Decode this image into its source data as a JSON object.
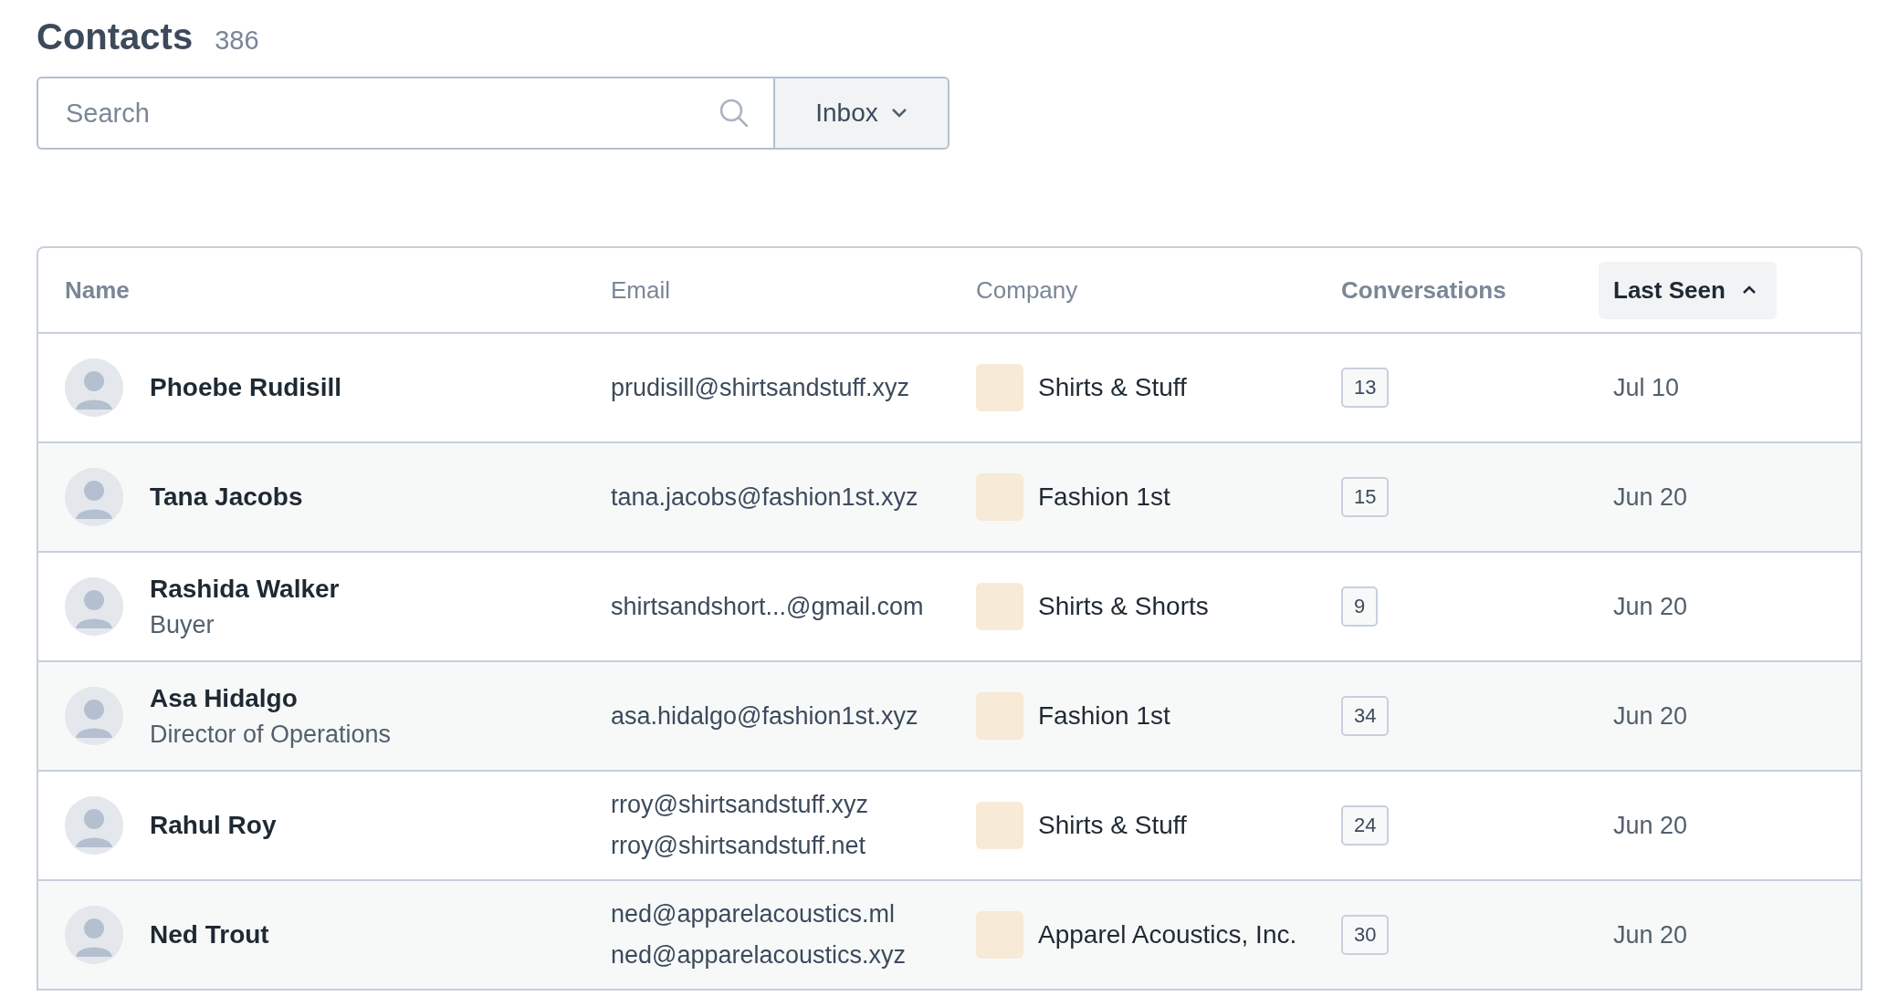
{
  "header": {
    "title": "Contacts",
    "count": "386"
  },
  "search": {
    "placeholder": "Search"
  },
  "filter": {
    "label": "Inbox"
  },
  "table": {
    "columns": [
      {
        "label": "Name",
        "sortable": true,
        "sorted": false
      },
      {
        "label": "Email",
        "sortable": false,
        "sorted": false
      },
      {
        "label": "Company",
        "sortable": false,
        "sorted": false
      },
      {
        "label": "Conversations",
        "sortable": true,
        "sorted": false
      },
      {
        "label": "Last Seen",
        "sortable": true,
        "sorted": true
      }
    ],
    "rows": [
      {
        "name": "Phoebe Rudisill",
        "emails": [
          "prudisill@shirtsandstuff.xyz"
        ],
        "company": "Shirts & Stuff",
        "conversations": "13",
        "last_seen": "Jul 10"
      },
      {
        "name": "Tana Jacobs",
        "emails": [
          "tana.jacobs@fashion1st.xyz"
        ],
        "company": "Fashion 1st",
        "conversations": "15",
        "last_seen": "Jun 20"
      },
      {
        "name": "Rashida Walker",
        "role": "Buyer",
        "emails": [
          "shirtsandshort...@gmail.com"
        ],
        "company": "Shirts & Shorts",
        "conversations": "9",
        "last_seen": "Jun 20"
      },
      {
        "name": "Asa Hidalgo",
        "role": "Director of Operations",
        "emails": [
          "asa.hidalgo@fashion1st.xyz"
        ],
        "company": "Fashion 1st",
        "conversations": "34",
        "last_seen": "Jun 20"
      },
      {
        "name": "Rahul Roy",
        "emails": [
          "rroy@shirtsandstuff.xyz",
          "rroy@shirtsandstuff.net"
        ],
        "company": "Shirts & Stuff",
        "conversations": "24",
        "last_seen": "Jun 20"
      },
      {
        "name": "Ned Trout",
        "emails": [
          "ned@apparelacoustics.ml",
          "ned@apparelacoustics.xyz"
        ],
        "company": "Apparel Acoustics, Inc.",
        "conversations": "30",
        "last_seen": "Jun 20"
      }
    ]
  }
}
